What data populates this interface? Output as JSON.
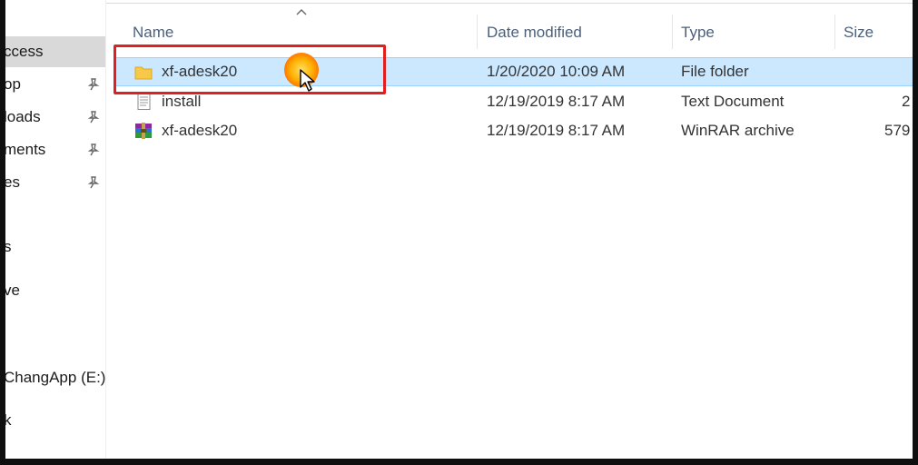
{
  "sidebar": {
    "items": [
      {
        "label": "ccess",
        "pinned": false,
        "selected": true
      },
      {
        "label": "op",
        "pinned": true
      },
      {
        "label": "loads",
        "pinned": true
      },
      {
        "label": "ments",
        "pinned": true
      },
      {
        "label": "es",
        "pinned": true
      },
      {
        "label": "s",
        "pinned": false
      },
      {
        "label": "ve",
        "pinned": false
      },
      {
        "label": "ChangApp (E:)",
        "pinned": false
      },
      {
        "label": "k",
        "pinned": false
      }
    ]
  },
  "columns": {
    "name": "Name",
    "date": "Date modified",
    "type": "Type",
    "size": "Size"
  },
  "files": [
    {
      "name": "xf-adesk20",
      "date": "1/20/2020 10:09 AM",
      "type": "File folder",
      "size": "",
      "icon": "folder-icon",
      "selected": true
    },
    {
      "name": "install",
      "date": "12/19/2019 8:17 AM",
      "type": "Text Document",
      "size": "2",
      "icon": "text-document-icon"
    },
    {
      "name": "xf-adesk20",
      "date": "12/19/2019 8:17 AM",
      "type": "WinRAR archive",
      "size": "579",
      "icon": "winrar-archive-icon"
    }
  ],
  "colors": {
    "selection": "#cce8ff",
    "highlight_box": "#e02020",
    "header_text": "#4c607a"
  }
}
